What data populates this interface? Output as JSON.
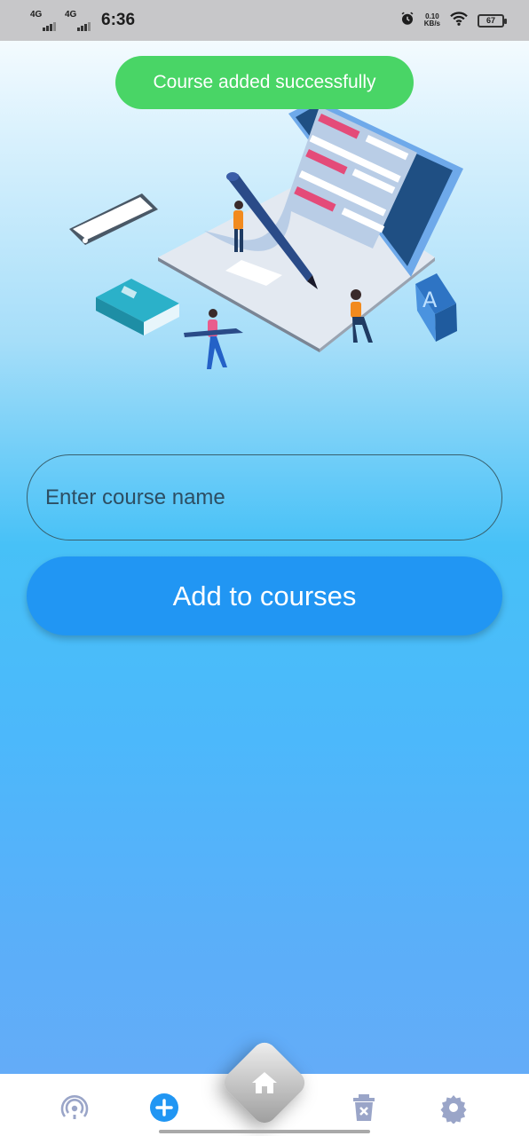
{
  "status_bar": {
    "sim1_network": "4G",
    "sim2_network": "4G",
    "time": "6:36",
    "speed_value": "0.10",
    "speed_unit": "KB/s",
    "battery_level": "67"
  },
  "toast": {
    "message": "Course added successfully",
    "color": "#49d566"
  },
  "form": {
    "course_input_placeholder": "Enter course name",
    "course_input_value": "",
    "add_button_label": "Add to courses",
    "button_color": "#2196f3"
  },
  "bottom_nav": {
    "items": [
      {
        "icon": "podcast-icon"
      },
      {
        "icon": "add-circle-icon"
      },
      {
        "icon": "home-icon",
        "selected": true
      },
      {
        "icon": "delete-icon"
      },
      {
        "icon": "settings-icon"
      }
    ]
  }
}
